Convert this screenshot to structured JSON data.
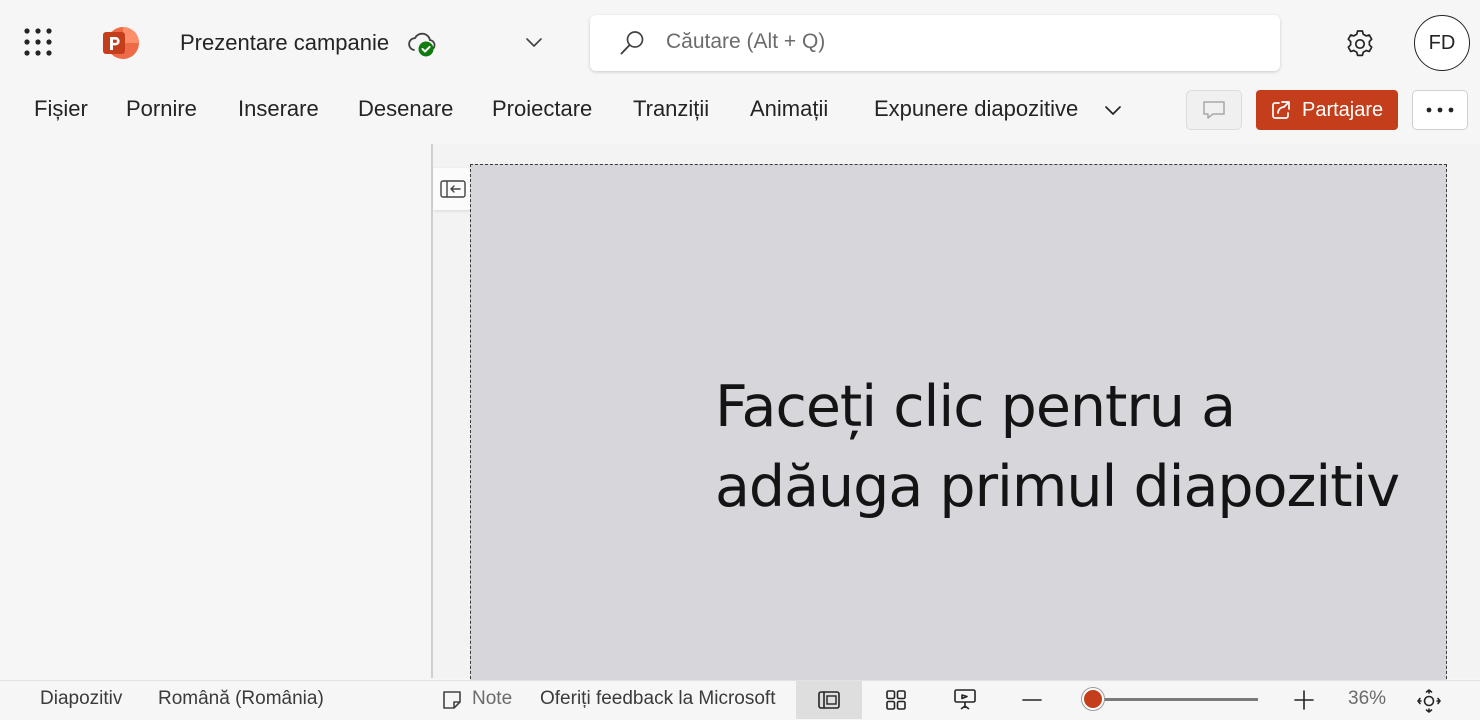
{
  "app": {
    "document_title": "Prezentare campanie",
    "accent_color": "#c43e1c"
  },
  "search": {
    "placeholder": "Căutare (Alt + Q)"
  },
  "user": {
    "initials": "FD"
  },
  "ribbon_tabs": [
    {
      "label": "Fișier"
    },
    {
      "label": "Pornire"
    },
    {
      "label": "Inserare"
    },
    {
      "label": "Desenare"
    },
    {
      "label": "Proiectare"
    },
    {
      "label": "Tranziții"
    },
    {
      "label": "Animații"
    },
    {
      "label": "Expunere diapozitive"
    }
  ],
  "actions": {
    "share_label": "Partajare"
  },
  "slide": {
    "placeholder_line1": "Faceți clic pentru a",
    "placeholder_line2": "adăuga primul diapozitiv"
  },
  "status": {
    "slide_label": "Diapozitiv",
    "language": "Română (România)",
    "notes_label": "Note",
    "feedback": "Oferiți feedback la Microsoft",
    "zoom_percent": "36%",
    "zoom_level": 36
  },
  "icons": {
    "waffle": "app-launcher-icon",
    "logo": "powerpoint-logo-icon",
    "cloud": "cloud-saved-icon",
    "search": "search-icon",
    "settings": "gear-icon",
    "comment": "comment-icon",
    "share": "share-icon",
    "more": "more-options-icon"
  }
}
